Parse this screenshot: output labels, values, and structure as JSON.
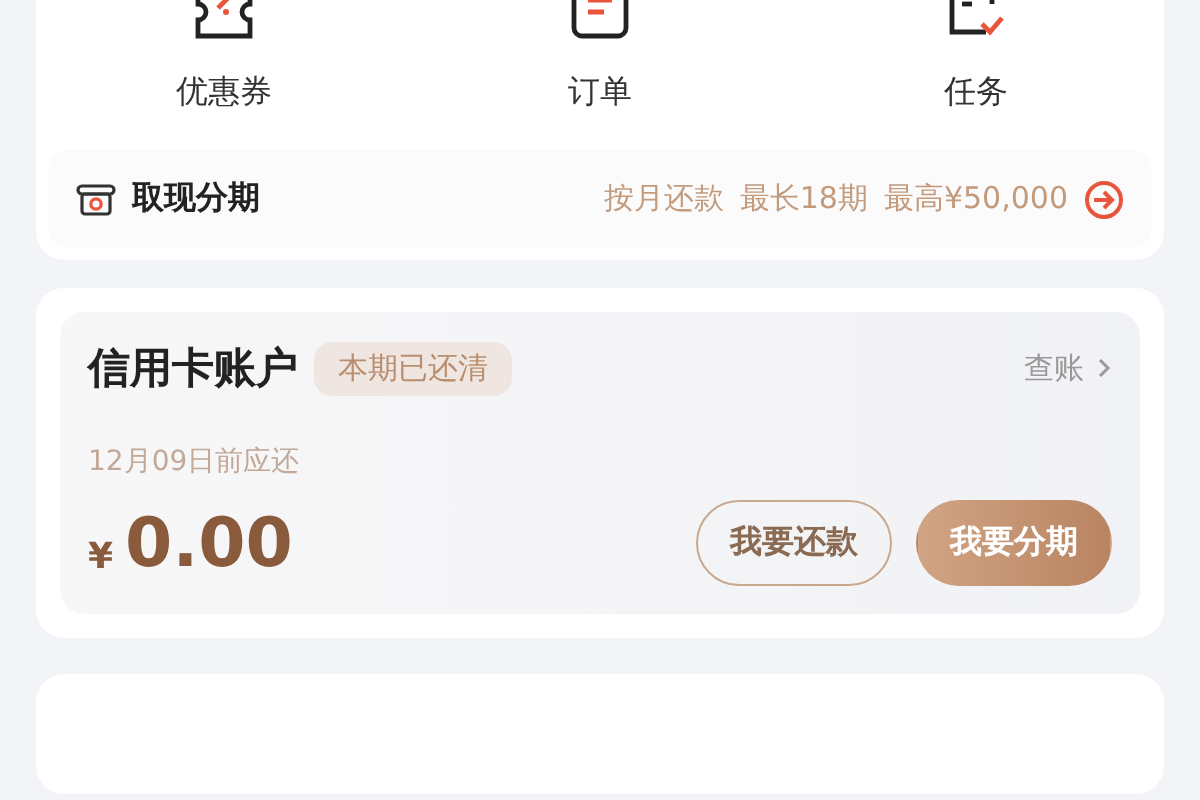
{
  "shortcuts": [
    {
      "label": "优惠券",
      "kind": "coupon"
    },
    {
      "label": "订单",
      "kind": "order"
    },
    {
      "label": "任务",
      "kind": "task"
    }
  ],
  "installment_banner": {
    "title": "取现分期",
    "tags": [
      "按月还款",
      "最长18期",
      "最高¥50,000"
    ]
  },
  "credit_account": {
    "title": "信用卡账户",
    "status_badge": "本期已还清",
    "link": "查账",
    "due_text": "12月09日前应还",
    "currency": "¥",
    "amount": "0.00",
    "buttons": [
      {
        "label": "我要还款",
        "kind": "outline"
      },
      {
        "label": "我要分期",
        "kind": "filled"
      }
    ]
  }
}
